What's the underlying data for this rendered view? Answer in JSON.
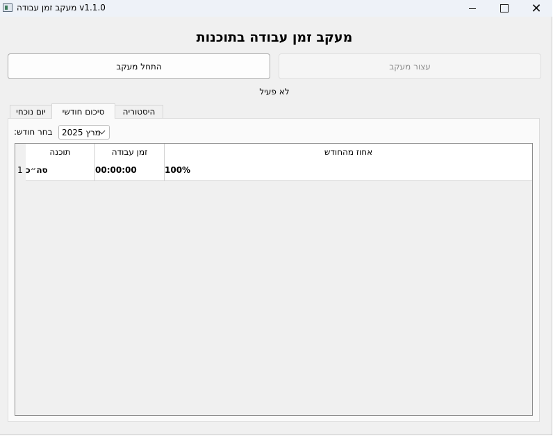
{
  "window": {
    "title": "מעקב זמן עבודה v1.1.0"
  },
  "app": {
    "heading": "מעקב זמן עבודה בתוכנות",
    "start_button": "התחל מעקב",
    "stop_button": "עצור מעקב",
    "status": "לא פעיל"
  },
  "tabs": [
    {
      "label": "יום נוכחי",
      "active": false
    },
    {
      "label": "סיכום חודשי",
      "active": true
    },
    {
      "label": "היסטוריה",
      "active": false
    }
  ],
  "month_select": {
    "label": "בחר חודש:",
    "value": "מרץ 2025"
  },
  "table": {
    "columns": [
      "תוכנה",
      "זמן עבודה",
      "אחוז מהחודש"
    ],
    "rows": [
      {
        "num": "1",
        "program": "סה״כ",
        "time": "00:00:00",
        "percent": "100%"
      }
    ]
  }
}
